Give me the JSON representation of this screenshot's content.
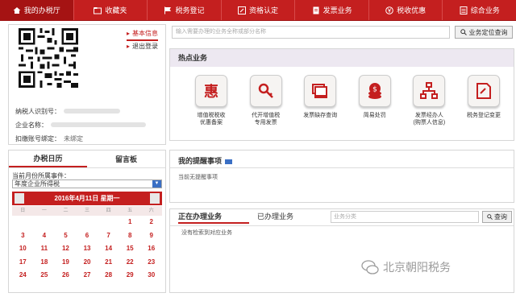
{
  "nav": [
    {
      "label": "我的办税厅",
      "icon": "home-icon",
      "active": true
    },
    {
      "label": "收藏夹",
      "icon": "folder-icon"
    },
    {
      "label": "税务登记",
      "icon": "flag-icon"
    },
    {
      "label": "资格认定",
      "icon": "edit-icon"
    },
    {
      "label": "发票业务",
      "icon": "invoice-icon"
    },
    {
      "label": "税收优惠",
      "icon": "yen-icon"
    },
    {
      "label": "综合业务",
      "icon": "list-icon"
    }
  ],
  "info": {
    "link_basic": "基本信息",
    "link_logout": "退出登录",
    "taxpayer_id_label": "纳税人识别号：",
    "company_label": "企业名称：",
    "bank_label": "扣缴账号绑定：",
    "bank_value": "未绑定"
  },
  "calendar": {
    "tab_calendar": "办税日历",
    "tab_board": "留言板",
    "subtitle": "当前月份所属事件：",
    "select_value": "年度企业所得税",
    "header": "2016年4月11日  星期一",
    "weekdays": [
      "日",
      "一",
      "二",
      "三",
      "四",
      "五",
      "六"
    ],
    "rows": [
      [
        "",
        "",
        "",
        "",
        "",
        "1",
        "2"
      ],
      [
        "3",
        "4",
        "5",
        "6",
        "7",
        "8",
        "9"
      ],
      [
        "10",
        "11",
        "12",
        "13",
        "14",
        "15",
        "16"
      ],
      [
        "17",
        "18",
        "19",
        "20",
        "21",
        "22",
        "23"
      ],
      [
        "24",
        "25",
        "26",
        "27",
        "28",
        "29",
        "30"
      ]
    ]
  },
  "search": {
    "placeholder": "输入需要办理的业务全称或部分名称",
    "button": "业务定位查询"
  },
  "hot": {
    "title": "热点业务",
    "items": [
      {
        "label": "增值税税收\n优惠备案",
        "icon": "hui-icon"
      },
      {
        "label": "代开增值税\n专用发票",
        "icon": "key-icon"
      },
      {
        "label": "发票缺存查询",
        "icon": "stack-icon"
      },
      {
        "label": "简易处罚",
        "icon": "coin-icon"
      },
      {
        "label": "发票经办人\n(购票人信息)",
        "icon": "org-chart-icon"
      },
      {
        "label": "税务登记变更",
        "icon": "doc-edit-icon"
      }
    ]
  },
  "reminders": {
    "title": "我的提醒事项",
    "empty": "当前无提醒事项"
  },
  "progress": {
    "tab_active": "正在办理业务",
    "tab_done": "已办理业务",
    "placeholder": "业务分类",
    "button": "查询",
    "empty": "没有检索到对应业务"
  },
  "watermark": "北京朝阳税务"
}
